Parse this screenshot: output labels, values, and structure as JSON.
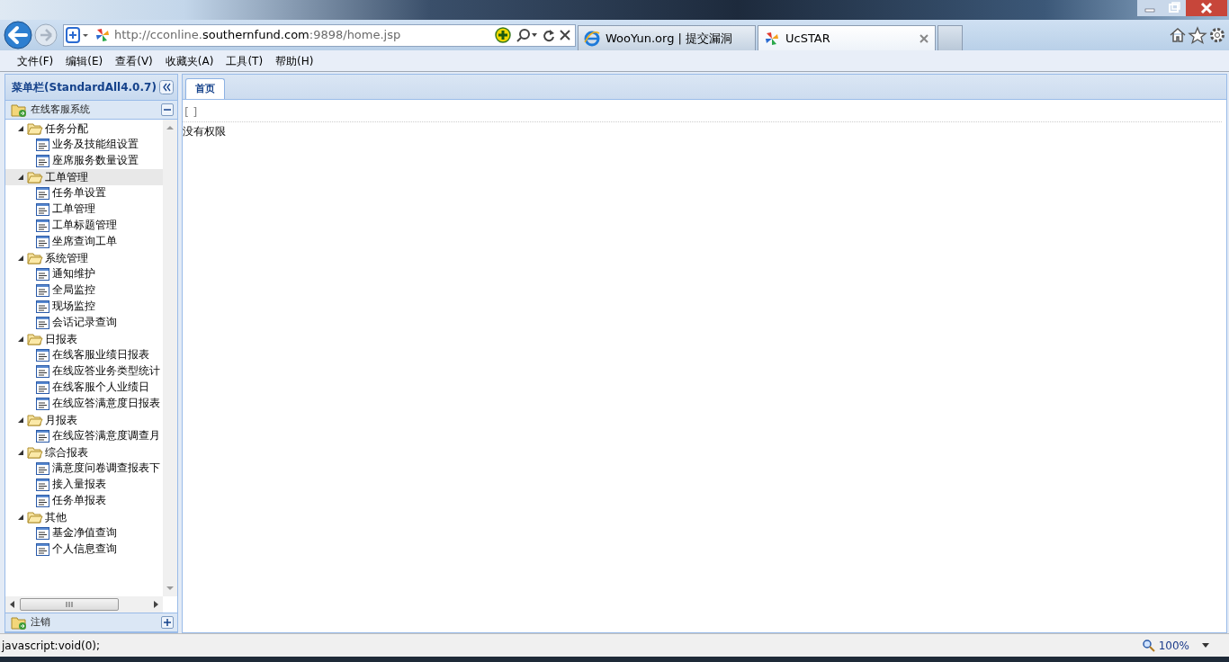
{
  "browser": {
    "url_parts": [
      {
        "text": "http://cconline.",
        "emphasis": false
      },
      {
        "text": "southernfund.com",
        "emphasis": true
      },
      {
        "text": ":9898/home.jsp",
        "emphasis": false
      }
    ],
    "tabs": [
      {
        "label": "WooYun.org | 提交漏洞",
        "selected": false
      },
      {
        "label": "UcSTAR",
        "selected": true
      }
    ],
    "menu": [
      "文件(F)",
      "编辑(E)",
      "查看(V)",
      "收藏夹(A)",
      "工具(T)",
      "帮助(H)"
    ]
  },
  "sidebar": {
    "title": "菜单栏(StandardAll4.0.7)",
    "sections": [
      {
        "label": "在线客服系统",
        "expanded": true
      },
      {
        "label": "注销",
        "expanded": false
      }
    ],
    "tree": [
      {
        "label": "任务分配",
        "selected": false,
        "expanded": true,
        "children": [
          {
            "label": "业务及技能组设置",
            "selected": false
          },
          {
            "label": "座席服务数量设置",
            "selected": false
          }
        ]
      },
      {
        "label": "工单管理",
        "selected": true,
        "expanded": true,
        "children": [
          {
            "label": "任务单设置",
            "selected": false
          },
          {
            "label": "工单管理",
            "selected": false
          },
          {
            "label": "工单标题管理",
            "selected": false
          },
          {
            "label": "坐席查询工单",
            "selected": false
          }
        ]
      },
      {
        "label": "系统管理",
        "selected": false,
        "expanded": true,
        "children": [
          {
            "label": "通知维护",
            "selected": false
          },
          {
            "label": "全局监控",
            "selected": false
          },
          {
            "label": "现场监控",
            "selected": false
          },
          {
            "label": "会话记录查询",
            "selected": false
          }
        ]
      },
      {
        "label": "日报表",
        "selected": false,
        "expanded": true,
        "children": [
          {
            "label": "在线客服业绩日报表",
            "selected": false
          },
          {
            "label": "在线应答业务类型统计",
            "selected": false
          },
          {
            "label": "在线客服个人业绩日",
            "selected": false
          },
          {
            "label": "在线应答满意度日报表",
            "selected": false
          }
        ]
      },
      {
        "label": "月报表",
        "selected": false,
        "expanded": true,
        "children": [
          {
            "label": "在线应答满意度调查月",
            "selected": false
          }
        ]
      },
      {
        "label": "综合报表",
        "selected": false,
        "expanded": true,
        "children": [
          {
            "label": "满意度问卷调查报表下",
            "selected": false
          },
          {
            "label": "接入量报表",
            "selected": false
          },
          {
            "label": "任务单报表",
            "selected": false
          }
        ]
      },
      {
        "label": "其他",
        "selected": false,
        "expanded": true,
        "children": [
          {
            "label": "基金净值查询",
            "selected": false
          },
          {
            "label": "个人信息查询",
            "selected": false
          }
        ]
      }
    ]
  },
  "content": {
    "tabs": [
      {
        "label": "首页",
        "selected": true
      }
    ],
    "bracket": "[ ]",
    "message": "没有权限"
  },
  "status_bar": {
    "text": "javascript:void(0);",
    "zoom": "100%"
  }
}
